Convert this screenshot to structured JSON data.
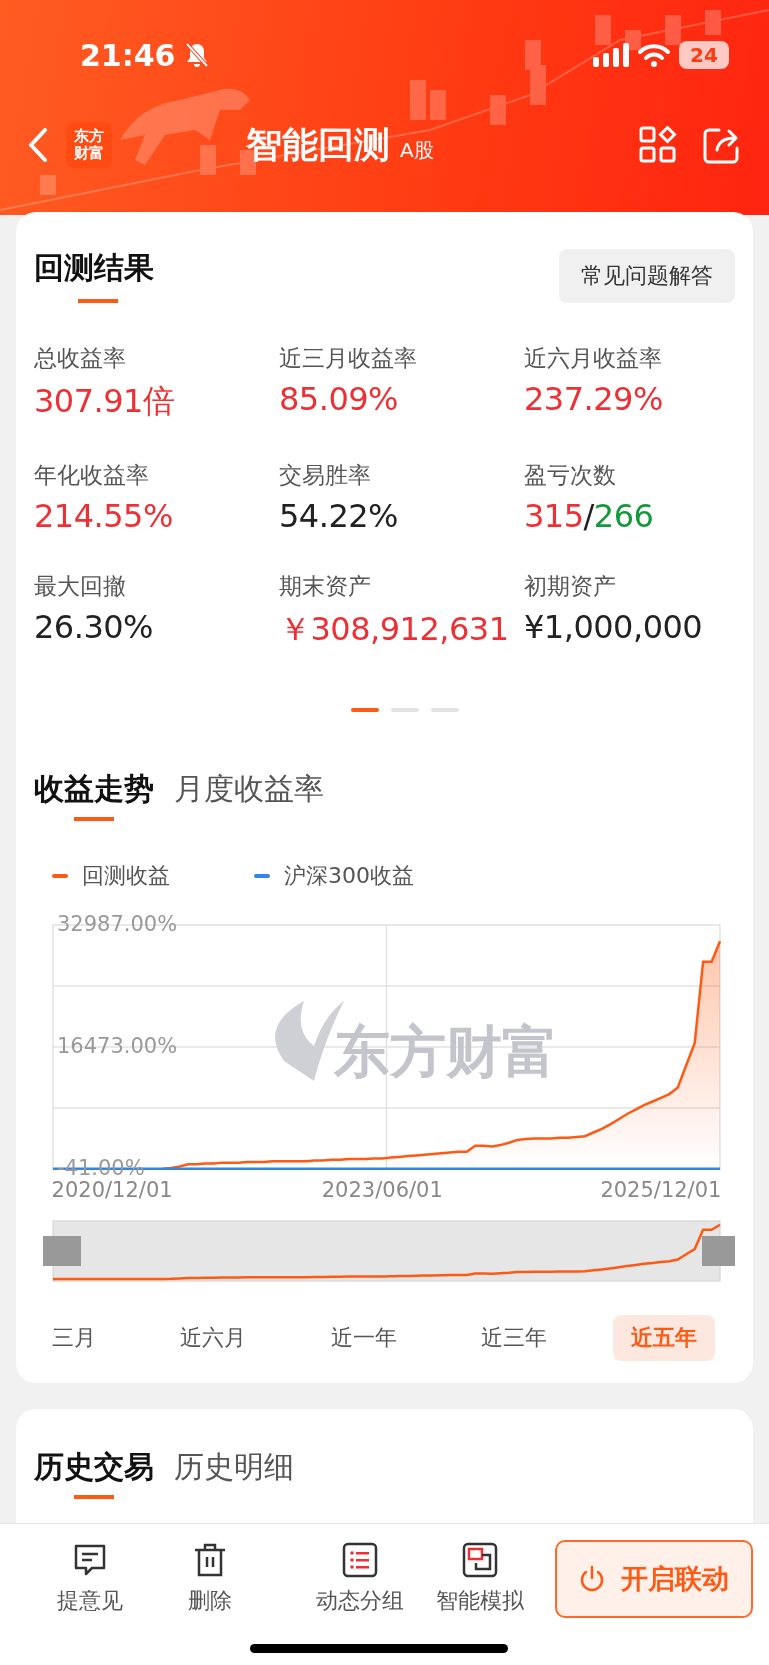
{
  "status_bar": {
    "time": "21:46",
    "battery": "24"
  },
  "header": {
    "logo": [
      "东方",
      "财富"
    ],
    "title": "智能回测",
    "badge": "A股"
  },
  "results": {
    "title": "回测结果",
    "faq_button": "常见问题解答",
    "stats": [
      {
        "label": "总收益率",
        "segments": [
          {
            "text": "307.91倍",
            "color": "#ee2f33"
          }
        ]
      },
      {
        "label": "近三月收益率",
        "segments": [
          {
            "text": "85.09%",
            "color": "#ee2f33"
          }
        ]
      },
      {
        "label": "近六月收益率",
        "segments": [
          {
            "text": "237.29%",
            "color": "#ee2f33"
          }
        ]
      },
      {
        "label": "年化收益率",
        "segments": [
          {
            "text": "214.55%",
            "color": "#ee2f33"
          }
        ]
      },
      {
        "label": "交易胜率",
        "segments": [
          {
            "text": "54.22%",
            "color": "#222222"
          }
        ]
      },
      {
        "label": "盈亏次数",
        "segments": [
          {
            "text": "315",
            "color": "#ee2f33"
          },
          {
            "text": "/",
            "color": "#222222"
          },
          {
            "text": "266",
            "color": "#12993a"
          }
        ]
      },
      {
        "label": "最大回撤",
        "segments": [
          {
            "text": "26.30%",
            "color": "#222222"
          }
        ]
      },
      {
        "label": "期末资产",
        "segments": [
          {
            "text": "￥308,912,631",
            "color": "#ee2f33"
          }
        ]
      },
      {
        "label": "初期资产",
        "segments": [
          {
            "text": "¥1,000,000",
            "color": "#222222"
          }
        ]
      }
    ],
    "pager": [
      {
        "selected": true
      },
      {
        "selected": false
      },
      {
        "selected": false
      }
    ]
  },
  "trend": {
    "tabs": [
      {
        "label": "收益走势",
        "selected": true
      },
      {
        "label": "月度收益率",
        "selected": false
      }
    ],
    "watermark": "东方财富",
    "chart_data": {
      "type": "area",
      "categories": [
        null,
        null,
        null,
        null,
        null,
        null,
        null,
        "2020/12/01",
        null,
        null,
        null,
        null,
        null,
        null,
        null,
        null,
        null,
        null,
        null,
        null,
        null,
        null,
        null,
        null,
        null,
        null,
        null,
        null,
        null,
        null,
        null,
        null,
        null,
        null,
        null,
        null,
        null,
        null,
        null,
        "2023/06/01",
        null,
        null,
        null,
        null,
        null,
        null,
        null,
        null,
        null,
        null,
        null,
        null,
        null,
        null,
        null,
        null,
        null,
        null,
        null,
        null,
        null,
        null,
        null,
        null,
        null,
        null,
        null,
        null,
        null,
        null,
        null,
        null,
        "2025/12/01",
        null,
        null,
        null,
        null,
        null,
        null,
        null
      ],
      "series": [
        {
          "name": "回测收益",
          "color": "#ff5a14",
          "values": [
            null,
            null,
            null,
            null,
            null,
            null,
            null,
            null,
            null,
            null,
            null,
            null,
            null,
            0,
            100,
            300,
            600,
            600,
            700,
            700,
            800,
            800,
            800,
            900,
            900,
            900,
            1000,
            1000,
            1000,
            1000,
            1000,
            1100,
            1100,
            1200,
            1200,
            1300,
            1300,
            1300,
            1400,
            1400,
            1500,
            1600,
            1700,
            1800,
            1900,
            2000,
            2100,
            2200,
            2300,
            2300,
            3100,
            3100,
            3000,
            3200,
            3500,
            3900,
            4000,
            4100,
            4100,
            4100,
            4200,
            4200,
            4300,
            4400,
            4900,
            5400,
            6000,
            6700,
            7400,
            8000,
            8600,
            9100,
            9600,
            10100,
            11000,
            14000,
            17000,
            28000,
            28000,
            30800
          ]
        },
        {
          "name": "沪深300收益",
          "color": "#2f86e8",
          "values": [
            0,
            0,
            0,
            0,
            0,
            0,
            0,
            0,
            0,
            0,
            0,
            0,
            0,
            0,
            0,
            0,
            0,
            0,
            0,
            0,
            0,
            0,
            0,
            0,
            0,
            0,
            0,
            0,
            0,
            0,
            0,
            0,
            0,
            0,
            0,
            0,
            0,
            0,
            0,
            0,
            0,
            0,
            0,
            0,
            0,
            0,
            0,
            0,
            0,
            0,
            0,
            0,
            0,
            0,
            0,
            0,
            0,
            0,
            0,
            0,
            0,
            0,
            0,
            0,
            0,
            0,
            0,
            0,
            0,
            0,
            0,
            0,
            0,
            0,
            0,
            0,
            0,
            0,
            0,
            0
          ]
        }
      ],
      "ylim": [
        -41,
        32987
      ],
      "yticks": [
        {
          "value": -41,
          "label": "-41.00%"
        },
        {
          "value": 16473,
          "label": "16473.00%"
        },
        {
          "value": 32987,
          "label": "32987.00%"
        }
      ]
    },
    "periods": [
      {
        "label": "三月",
        "selected": false
      },
      {
        "label": "近六月",
        "selected": false
      },
      {
        "label": "近一年",
        "selected": false
      },
      {
        "label": "近三年",
        "selected": false
      },
      {
        "label": "近五年",
        "selected": true
      }
    ]
  },
  "history": {
    "tabs": [
      {
        "label": "历史交易",
        "selected": true
      },
      {
        "label": "历史明细",
        "selected": false
      }
    ]
  },
  "bottom_bar": {
    "actions": [
      {
        "label": "提意见",
        "kind": "feedback"
      },
      {
        "label": "删除",
        "kind": "delete"
      },
      {
        "label": "动态分组",
        "kind": "group"
      },
      {
        "label": "智能模拟",
        "kind": "simulate"
      }
    ],
    "primary_button": "开启联动"
  }
}
